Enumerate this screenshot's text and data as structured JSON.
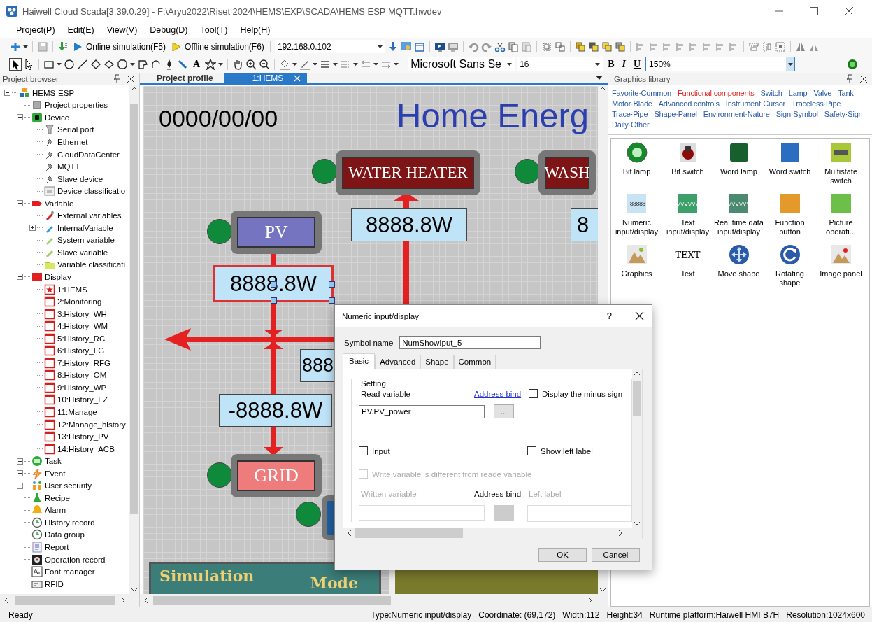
{
  "window": {
    "title": "Haiwell Cloud Scada[3.39.0.29] - F:\\Aryu2022\\Riset 2024\\HEMS\\EXP\\SCADA\\HEMS ESP MQTT.hwdev"
  },
  "menu": [
    "Project(P)",
    "Edit(E)",
    "View(V)",
    "Debug(D)",
    "Tool(T)",
    "Help(H)"
  ],
  "toolbar": {
    "online": "Online simulation(F5)",
    "offline": "Offline simulation(F6)",
    "ip": "192.168.0.102",
    "text_tool": "A",
    "font": "Microsoft Sans Se",
    "font_size": "16",
    "bold": "B",
    "italic": "I",
    "underline": "U",
    "zoom": "150%"
  },
  "project_browser": {
    "title": "Project browser",
    "tree": [
      {
        "label": "HEMS-ESP",
        "kind": "project",
        "expanded": true,
        "children": [
          {
            "label": "Project properties",
            "kind": "properties"
          },
          {
            "label": "Device",
            "kind": "device",
            "expanded": true,
            "children": [
              {
                "label": "Serial port",
                "kind": "port"
              },
              {
                "label": "Ethernet",
                "kind": "plug"
              },
              {
                "label": "CloudDataCenter",
                "kind": "plug"
              },
              {
                "label": "MQTT",
                "kind": "plug"
              },
              {
                "label": "Slave device",
                "kind": "plug"
              },
              {
                "label": "Device classificatio",
                "kind": "classify"
              }
            ]
          },
          {
            "label": "Variable",
            "kind": "variable",
            "expanded": true,
            "children": [
              {
                "label": "External variables",
                "kind": "tag-red"
              },
              {
                "label": "InternalVariable",
                "kind": "tag-blue",
                "expanded": false
              },
              {
                "label": "System variable",
                "kind": "tag-green"
              },
              {
                "label": "Slave variable",
                "kind": "tag-green"
              },
              {
                "label": "Variable classificati",
                "kind": "folder"
              }
            ]
          },
          {
            "label": "Display",
            "kind": "display",
            "expanded": true,
            "children": [
              {
                "label": "1:HEMS",
                "kind": "start-page"
              },
              {
                "label": "2:Monitoring",
                "kind": "page"
              },
              {
                "label": "3:History_WH",
                "kind": "page"
              },
              {
                "label": "4:History_WM",
                "kind": "page"
              },
              {
                "label": "5:History_RC",
                "kind": "page"
              },
              {
                "label": "6:History_LG",
                "kind": "page"
              },
              {
                "label": "7:History_RFG",
                "kind": "page"
              },
              {
                "label": "8:History_OM",
                "kind": "page"
              },
              {
                "label": "9:History_WP",
                "kind": "page"
              },
              {
                "label": "10:History_FZ",
                "kind": "page"
              },
              {
                "label": "11:Manage",
                "kind": "page"
              },
              {
                "label": "12:Manage_history",
                "kind": "page"
              },
              {
                "label": "13:History_PV",
                "kind": "page"
              },
              {
                "label": "14:History_ACB",
                "kind": "page"
              }
            ]
          },
          {
            "label": "Task",
            "kind": "task",
            "expanded": false
          },
          {
            "label": "Event",
            "kind": "event",
            "expanded": false
          },
          {
            "label": "User security",
            "kind": "users",
            "expanded": false
          },
          {
            "label": "Recipe",
            "kind": "recipe"
          },
          {
            "label": "Alarm",
            "kind": "alarm"
          },
          {
            "label": "History record",
            "kind": "clock"
          },
          {
            "label": "Data group",
            "kind": "clock"
          },
          {
            "label": "Report",
            "kind": "report"
          },
          {
            "label": "Operation record",
            "kind": "record"
          },
          {
            "label": "Font manager",
            "kind": "font"
          },
          {
            "label": "RFID",
            "kind": "rfid"
          }
        ]
      }
    ]
  },
  "editor_tabs": [
    {
      "label": "Project profile",
      "selected": false
    },
    {
      "label": "1:HEMS",
      "selected": true
    }
  ],
  "canvas": {
    "date": "0000/00/00",
    "title": "Home Energ",
    "devices": [
      {
        "label": "WATER HEATER",
        "color": "#7d1416"
      },
      {
        "label": "WASH",
        "color": "#7d1416"
      },
      {
        "label": "PV",
        "color": "#7474c0"
      },
      {
        "label": "GRID",
        "color": "#ef7c7c"
      }
    ],
    "readings": [
      {
        "value": "8888.8W",
        "selected": false
      },
      {
        "value": "8",
        "selected": false
      },
      {
        "value": "8888.8W",
        "selected": true
      },
      {
        "value": "888",
        "selected": false
      },
      {
        "value": "-8888.8W",
        "selected": false
      }
    ],
    "panel": {
      "title": "Simulation",
      "mode": "Mode"
    }
  },
  "graphics_library": {
    "title": "Graphics library",
    "categories": [
      {
        "label": "Favorite·Common",
        "selected": false
      },
      {
        "label": "Functional components",
        "selected": true
      },
      {
        "label": "Switch",
        "selected": false
      },
      {
        "label": "Lamp",
        "selected": false
      },
      {
        "label": "Valve",
        "selected": false
      },
      {
        "label": "Tank",
        "selected": false
      },
      {
        "label": "Motor·Blade",
        "selected": false
      },
      {
        "label": "Advanced controls",
        "selected": false
      },
      {
        "label": "Instrument·Cursor",
        "selected": false
      },
      {
        "label": "Traceless·Pipe",
        "selected": false
      },
      {
        "label": "Trace·Pipe",
        "selected": false
      },
      {
        "label": "Shape·Panel",
        "selected": false
      },
      {
        "label": "Environment·Nature",
        "selected": false
      },
      {
        "label": "Sign·Symbol",
        "selected": false
      },
      {
        "label": "Safety·Sign",
        "selected": false
      },
      {
        "label": "Daily·Other",
        "selected": false
      }
    ],
    "items": [
      {
        "label": "Bit lamp",
        "kind": "bit-lamp"
      },
      {
        "label": "Bit switch",
        "kind": "bit-switch"
      },
      {
        "label": "Word lamp",
        "kind": "word-lamp"
      },
      {
        "label": "Word switch",
        "kind": "word-switch"
      },
      {
        "label": "Multistate switch",
        "kind": "multistate"
      },
      {
        "label": "Numeric input/display",
        "kind": "numeric",
        "icon_text": "-88888"
      },
      {
        "label": "Text input/display",
        "kind": "text-io",
        "icon_text": "AAAAA"
      },
      {
        "label": "Real time data input/display",
        "kind": "realtime",
        "icon_text": "AAAAA"
      },
      {
        "label": "Function button",
        "kind": "function"
      },
      {
        "label": "Picture operati...",
        "kind": "picture-op"
      },
      {
        "label": "Graphics",
        "kind": "graphics"
      },
      {
        "label": "Text",
        "kind": "text",
        "icon_text": "TEXT"
      },
      {
        "label": "Move shape",
        "kind": "move"
      },
      {
        "label": "Rotating shape",
        "kind": "rotate"
      },
      {
        "label": "Image panel",
        "kind": "image-panel"
      }
    ]
  },
  "dialog": {
    "title": "Numeric input/display",
    "help": "?",
    "symbol_label": "Symbol name",
    "symbol_value": "NumShowIput_5",
    "tabs": [
      {
        "label": "Basic",
        "selected": true
      },
      {
        "label": "Advanced",
        "selected": false
      },
      {
        "label": "Shape",
        "selected": false
      },
      {
        "label": "Common",
        "selected": false
      }
    ],
    "group": "Setting",
    "read_label": "Read variable",
    "address_link": "Address bind",
    "read_value": "PV.PV_power",
    "browse": "...",
    "checkboxes": [
      {
        "label": "Display the minus sign",
        "checked": false,
        "disabled": false
      },
      {
        "label": "Input",
        "checked": false,
        "disabled": false
      },
      {
        "label": "Show left label",
        "checked": false,
        "disabled": false
      },
      {
        "label": "Write variable is different from reade variable",
        "checked": false,
        "disabled": true
      }
    ],
    "written_label": "Written variable",
    "address_label": "Address bind",
    "left_label": "Left label",
    "buttons": [
      "OK",
      "Cancel"
    ]
  },
  "status_bar": {
    "left": "Ready",
    "items": [
      "Type:Numeric input/display",
      "Coordinate: (69,172)",
      "Width:112",
      "Height:34",
      "Runtime platform:Haiwell HMI B7H",
      "Resolution:1024x600"
    ]
  }
}
